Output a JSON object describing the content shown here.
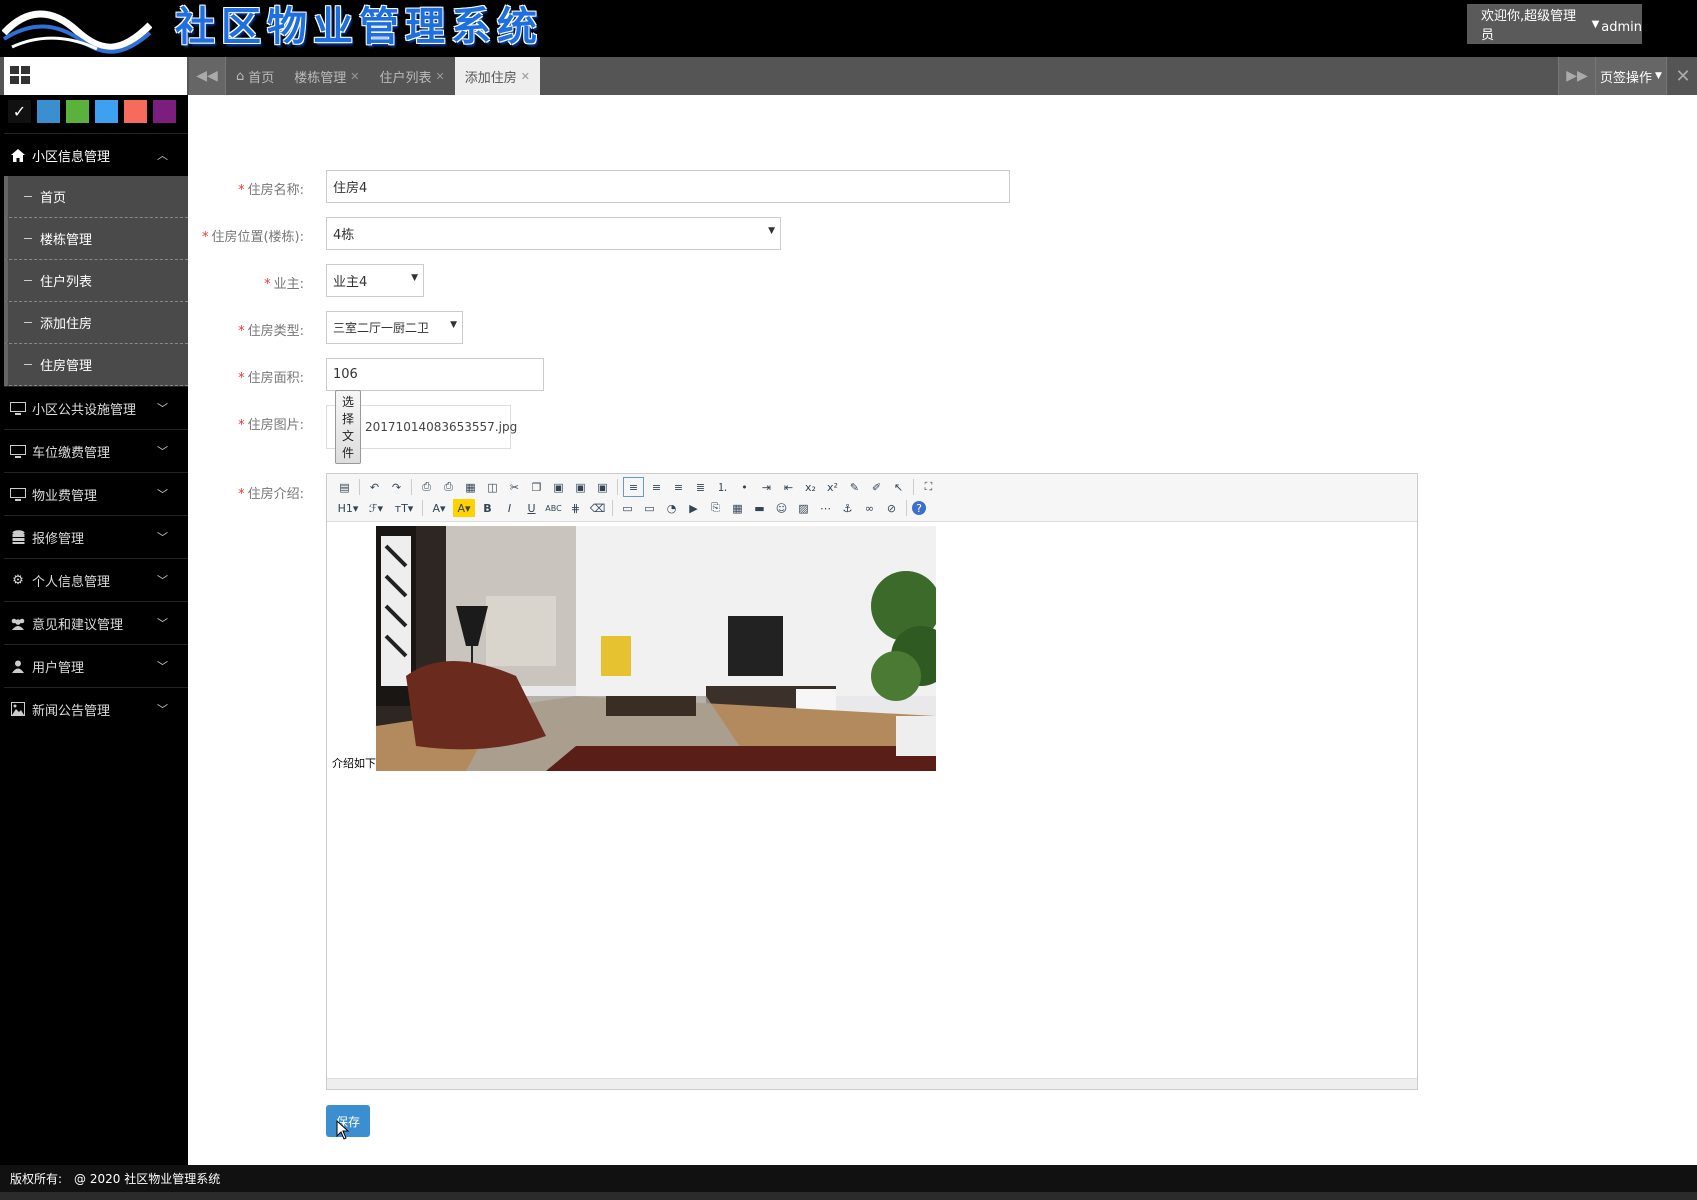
{
  "header": {
    "app_title": "社区物业管理系统",
    "welcome": "欢迎你,超级管理员",
    "username": "admin"
  },
  "tabs": [
    {
      "label": "首页",
      "closable": false,
      "active": false
    },
    {
      "label": "楼栋管理",
      "closable": true,
      "active": false
    },
    {
      "label": "住户列表",
      "closable": true,
      "active": false
    },
    {
      "label": "添加住房",
      "closable": true,
      "active": true
    }
  ],
  "tab_controls": {
    "page_ops": "页签操作"
  },
  "theme_colors": [
    "#111111",
    "#3a8fd0",
    "#5ab13c",
    "#3ea0f0",
    "#f66b5b",
    "#7b1e7e"
  ],
  "sidebar": {
    "sections": [
      {
        "label": "小区信息管理",
        "icon": "home-icon",
        "open": true,
        "items": [
          {
            "label": "首页"
          },
          {
            "label": "楼栋管理"
          },
          {
            "label": "住户列表"
          },
          {
            "label": "添加住房"
          },
          {
            "label": "住房管理"
          }
        ]
      },
      {
        "label": "小区公共设施管理",
        "icon": "monitor-icon",
        "open": false
      },
      {
        "label": "车位缴费管理",
        "icon": "monitor-icon",
        "open": false
      },
      {
        "label": "物业费管理",
        "icon": "monitor-icon",
        "open": false
      },
      {
        "label": "报修管理",
        "icon": "database-icon",
        "open": false
      },
      {
        "label": "个人信息管理",
        "icon": "gears-icon",
        "open": false
      },
      {
        "label": "意见和建议管理",
        "icon": "users-icon",
        "open": false
      },
      {
        "label": "用户管理",
        "icon": "user-icon",
        "open": false
      },
      {
        "label": "新闻公告管理",
        "icon": "picture-icon",
        "open": false
      }
    ]
  },
  "form": {
    "name_label": "住房名称:",
    "name_value": "住房4",
    "location_label": "住房位置(楼栋):",
    "location_value": "4栋",
    "owner_label": "业主:",
    "owner_value": "业主4",
    "type_label": "住房类型:",
    "type_value": "三室二厅一厨二卫",
    "area_label": "住房面积:",
    "area_value": "106",
    "image_label": "住房图片:",
    "file_button": "选择文件",
    "file_name": "20171014083653557.jpg",
    "intro_label": "住房介绍:",
    "intro_text": "介绍如下",
    "save_label": "保存"
  },
  "footer": {
    "copyright_label": "版权所有:",
    "copyright_text": "@ 2020 社区物业管理系统"
  }
}
